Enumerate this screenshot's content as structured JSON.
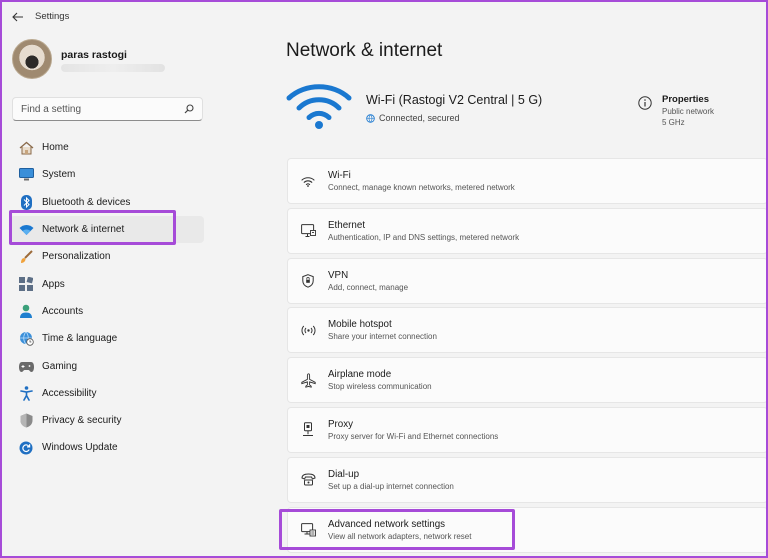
{
  "app": {
    "title": "Settings"
  },
  "profile": {
    "name": "paras rastogi"
  },
  "search": {
    "placeholder": "Find a setting"
  },
  "nav": {
    "items": [
      {
        "label": "Home",
        "icon": "home-icon"
      },
      {
        "label": "System",
        "icon": "system-icon"
      },
      {
        "label": "Bluetooth & devices",
        "icon": "bluetooth-icon"
      },
      {
        "label": "Network & internet",
        "icon": "wifi-icon",
        "active": true
      },
      {
        "label": "Personalization",
        "icon": "brush-icon"
      },
      {
        "label": "Apps",
        "icon": "apps-icon"
      },
      {
        "label": "Accounts",
        "icon": "accounts-icon"
      },
      {
        "label": "Time & language",
        "icon": "globe-clock-icon"
      },
      {
        "label": "Gaming",
        "icon": "gamepad-icon"
      },
      {
        "label": "Accessibility",
        "icon": "accessibility-icon"
      },
      {
        "label": "Privacy & security",
        "icon": "shield-icon"
      },
      {
        "label": "Windows Update",
        "icon": "update-icon"
      }
    ]
  },
  "main": {
    "title": "Network & internet",
    "hero": {
      "network_name": "Wi-Fi (Rastogi V2 Central |  5 G)",
      "status": "Connected, secured"
    },
    "properties": {
      "title": "Properties",
      "line1": "Public network",
      "line2": "5 GHz"
    },
    "cards": [
      {
        "title": "Wi-Fi",
        "desc": "Connect, manage known networks, metered network",
        "icon": "wifi-small-icon"
      },
      {
        "title": "Ethernet",
        "desc": "Authentication, IP and DNS settings, metered network",
        "icon": "ethernet-icon"
      },
      {
        "title": "VPN",
        "desc": "Add, connect, manage",
        "icon": "vpn-shield-icon"
      },
      {
        "title": "Mobile hotspot",
        "desc": "Share your internet connection",
        "icon": "hotspot-icon"
      },
      {
        "title": "Airplane mode",
        "desc": "Stop wireless communication",
        "icon": "airplane-icon"
      },
      {
        "title": "Proxy",
        "desc": "Proxy server for Wi-Fi and Ethernet connections",
        "icon": "proxy-icon"
      },
      {
        "title": "Dial-up",
        "desc": "Set up a dial-up internet connection",
        "icon": "dialup-icon"
      },
      {
        "title": "Advanced network settings",
        "desc": "View all network adapters, network reset",
        "icon": "advanced-network-icon"
      }
    ]
  },
  "colors": {
    "accent": "#0067c0",
    "highlight": "#a64bd8"
  }
}
